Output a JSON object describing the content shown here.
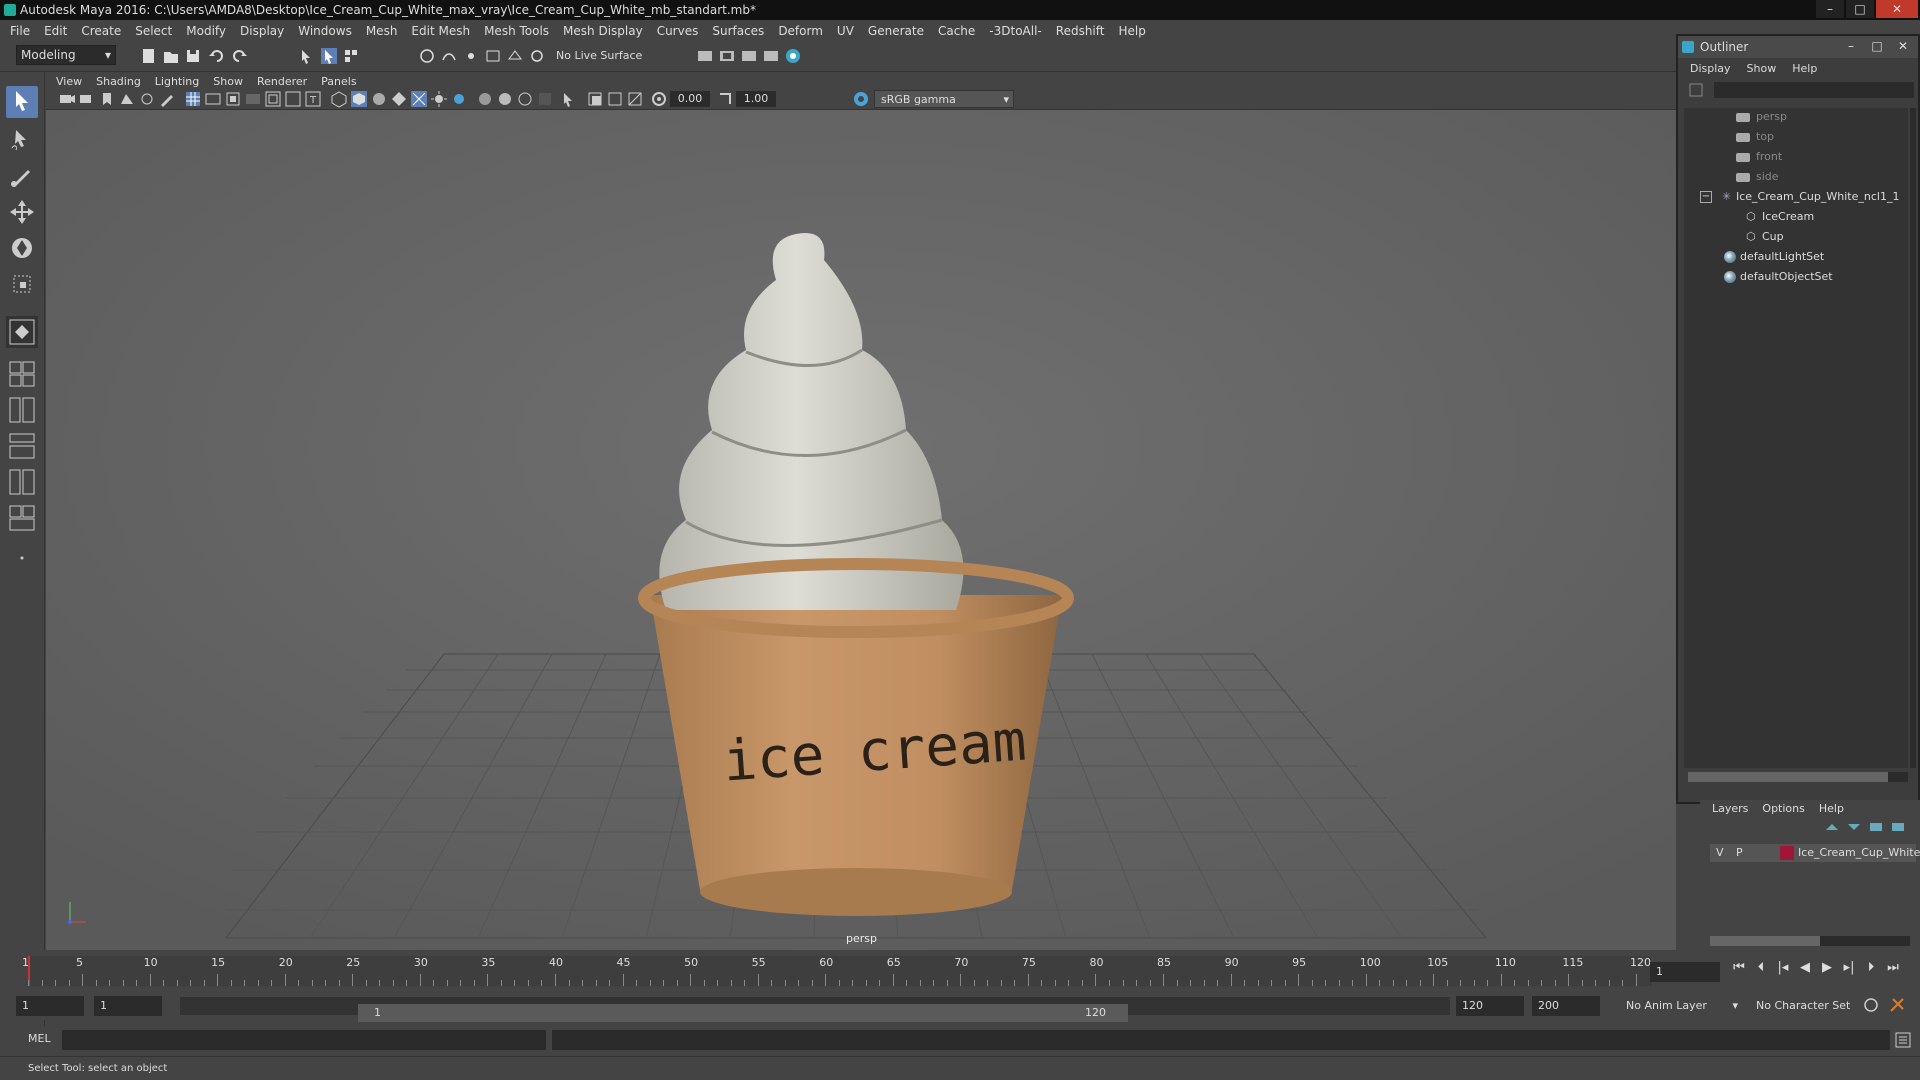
{
  "window": {
    "title": "Autodesk Maya 2016: C:\\Users\\AMDA8\\Desktop\\Ice_Cream_Cup_White_max_vray\\Ice_Cream_Cup_White_mb_standart.mb*"
  },
  "menubar": {
    "items": [
      "File",
      "Edit",
      "Create",
      "Select",
      "Modify",
      "Display",
      "Windows",
      "Mesh",
      "Edit Mesh",
      "Mesh Tools",
      "Mesh Display",
      "Curves",
      "Surfaces",
      "Deform",
      "UV",
      "Generate",
      "Cache",
      "-3DtoAll-",
      "Redshift",
      "Help"
    ]
  },
  "shelf": {
    "mode": "Modeling",
    "live_surface": "No Live Surface"
  },
  "viewport": {
    "menu": [
      "View",
      "Shading",
      "Lighting",
      "Show",
      "Renderer",
      "Panels"
    ],
    "exposure": "0.00",
    "gamma_value": "1.00",
    "color_space": "sRGB gamma",
    "camera_label": "persp",
    "cup_text": "ice cream"
  },
  "outliner": {
    "title": "Outliner",
    "menu": [
      "Display",
      "Show",
      "Help"
    ],
    "items": [
      {
        "label": "persp",
        "type": "camera"
      },
      {
        "label": "top",
        "type": "camera"
      },
      {
        "label": "front",
        "type": "camera"
      },
      {
        "label": "side",
        "type": "camera"
      },
      {
        "label": "Ice_Cream_Cup_White_ncl1_1",
        "type": "group"
      },
      {
        "label": "IceCream",
        "type": "mesh"
      },
      {
        "label": "Cup",
        "type": "mesh"
      },
      {
        "label": "defaultLightSet",
        "type": "set"
      },
      {
        "label": "defaultObjectSet",
        "type": "set"
      }
    ]
  },
  "layers": {
    "menu": [
      "Layers",
      "Options",
      "Help"
    ],
    "row": {
      "v": "V",
      "p": "P",
      "name": "Ice_Cream_Cup_White",
      "color": "#a0153a"
    }
  },
  "timeline": {
    "ticks": [
      "1",
      "5",
      "10",
      "15",
      "20",
      "25",
      "30",
      "35",
      "40",
      "45",
      "50",
      "55",
      "60",
      "65",
      "70",
      "75",
      "80",
      "85",
      "90",
      "95",
      "100",
      "105",
      "110",
      "115",
      "120"
    ],
    "current_frame": "1"
  },
  "range": {
    "start": "1",
    "playback_start": "1",
    "slider_start": "1",
    "slider_end": "120",
    "playback_end": "120",
    "end": "200",
    "anim_layer": "No Anim Layer",
    "character_set": "No Character Set"
  },
  "command": {
    "label": "MEL"
  },
  "helpline": {
    "text": "Select Tool: select an object"
  }
}
